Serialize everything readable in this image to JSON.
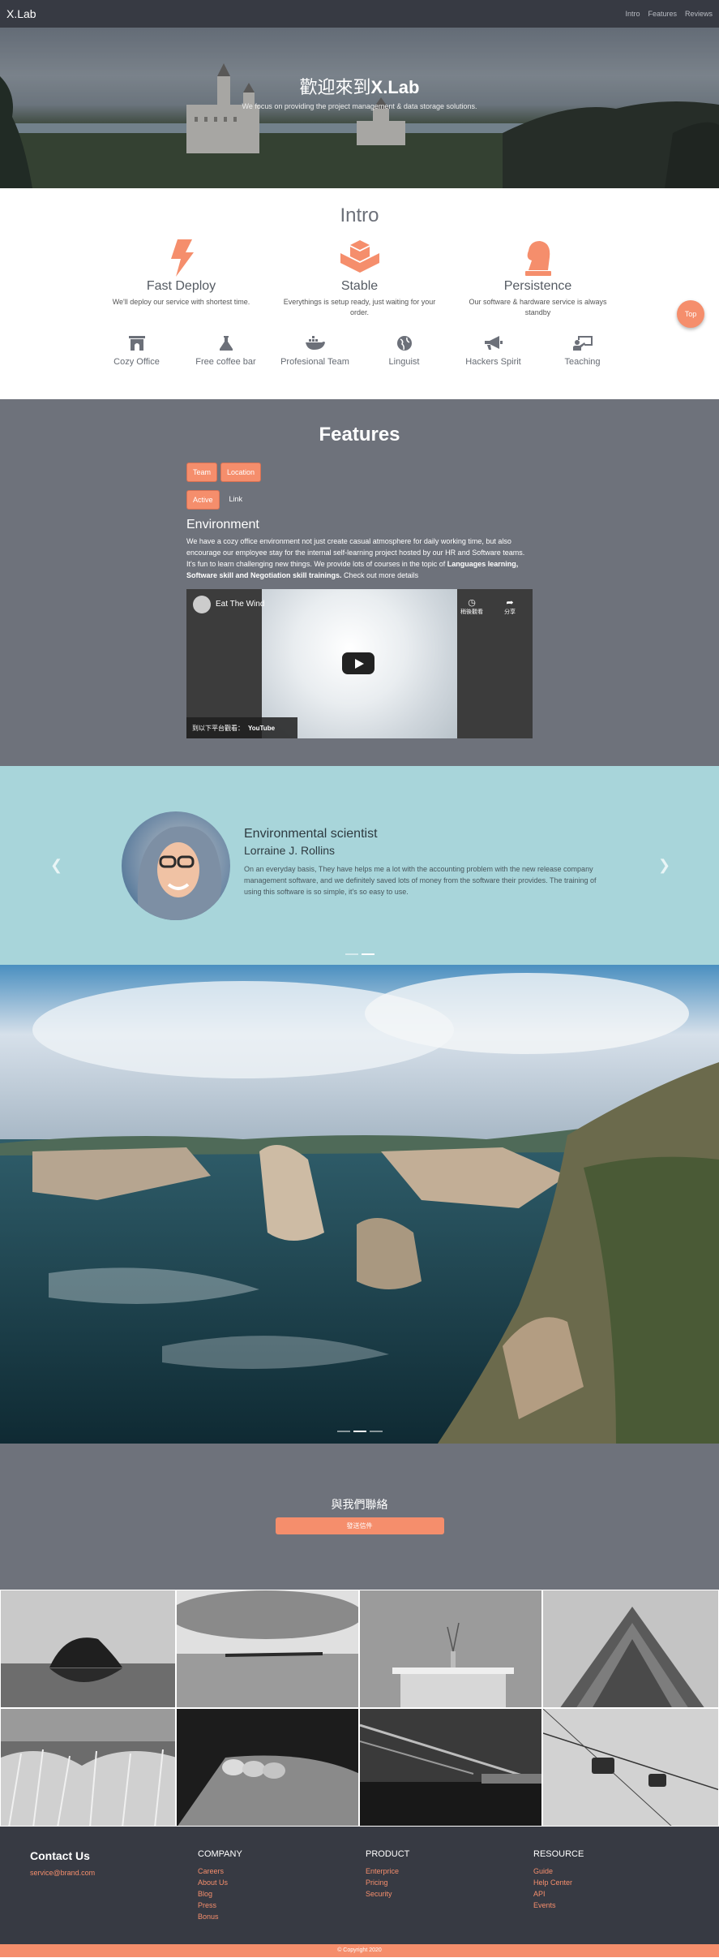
{
  "nav": {
    "brand": "X.Lab",
    "links": [
      "Intro",
      "Features",
      "Reviews"
    ]
  },
  "hero": {
    "title_prefix": "歡迎來到",
    "title_brand": "X.Lab",
    "subtitle": "We focus on providing the project management & data storage solutions."
  },
  "intro": {
    "title": "Intro",
    "main_features": [
      {
        "icon": "lightning-bolt-icon",
        "title": "Fast Deploy",
        "desc": "We'll deploy our service with shortest time."
      },
      {
        "icon": "cubes-icon",
        "title": "Stable",
        "desc": "Everythings is setup ready, just waiting for your order."
      },
      {
        "icon": "chess-knight-icon",
        "title": "Persistence",
        "desc": "Our software & hardware service is always standby"
      }
    ],
    "perks": [
      {
        "icon": "archway-icon",
        "label": "Cozy Office"
      },
      {
        "icon": "flask-icon",
        "label": "Free coffee bar"
      },
      {
        "icon": "docker-whale-icon",
        "label": "Profesional Team"
      },
      {
        "icon": "globe-icon",
        "label": "Linguist"
      },
      {
        "icon": "megaphone-icon",
        "label": "Hackers Spirit"
      },
      {
        "icon": "chalkboard-teacher-icon",
        "label": "Teaching"
      }
    ],
    "top_button": "Top"
  },
  "features": {
    "title": "Features",
    "pills": [
      "Team",
      "Location"
    ],
    "tabs": [
      "Active",
      "Link"
    ],
    "env_title": "Environment",
    "env_text_1": "We have a cozy office environment not just create casual atmosphere for daily working time, but also encourage our employee stay for the internal self-learning project hosted by our HR and Software teams. It's fun to learn challenging new things. We provide lots of courses in the topic of ",
    "env_text_bold": "Languages learning, Software skill and Negotiation skill trainings.",
    "env_text_2": " Check out more details",
    "video": {
      "title": "Eat The Wind",
      "watch_later": "稍後觀看",
      "share": "分享",
      "watch_on": "到以下平台觀看：",
      "platform": "YouTube"
    }
  },
  "testimonial": {
    "role": "Environmental scientist",
    "name": "Lorraine J. Rollins",
    "quote": "On an everyday basis, They have helps me a lot with the accounting problem with the new release company management software, and we definitely saved lots of money from the software their provides. The training of using this software is so simple, it's so easy to use."
  },
  "contact": {
    "title": "與我們聯絡",
    "button": "發送信件"
  },
  "footer": {
    "contact_title": "Contact Us",
    "email": "service@brand.com",
    "columns": [
      {
        "title": "COMPANY",
        "links": [
          "Careers",
          "About Us",
          "Blog",
          "Press",
          "Bonus"
        ]
      },
      {
        "title": "PRODUCT",
        "links": [
          "Enterprice",
          "Pricing",
          "Security"
        ]
      },
      {
        "title": "RESOURCE",
        "links": [
          "Guide",
          "Help Center",
          "API",
          "Events"
        ]
      }
    ],
    "copyright": "© Copyright 2020"
  },
  "colors": {
    "accent": "#f58e6c",
    "dark": "#373a43",
    "slate": "#6e727b",
    "mint": "#a8d5da"
  }
}
